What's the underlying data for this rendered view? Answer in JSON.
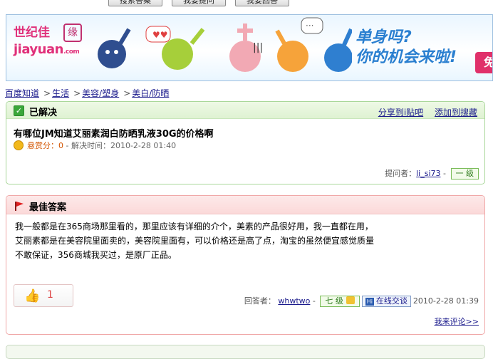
{
  "top_buttons": [
    "搜索答案",
    "我要提问",
    "我要回答"
  ],
  "banner": {
    "logo_cn": "世纪佳",
    "logo_mark": "缘",
    "logo_en": "jiayuan",
    "logo_domain": ".com",
    "slogan_line1": "单身吗?",
    "slogan_line2": "你的机会来啦!",
    "button_label": "免"
  },
  "breadcrumb": [
    "百度知道",
    "生活",
    "美容/塑身",
    "美白/防晒"
  ],
  "breadcrumb_sep": ">",
  "question": {
    "status": "已解决",
    "share_link": "分享到i贴吧",
    "favorite_link": "添加到搜藏",
    "title": "有哪位JM知道艾丽素润白防晒乳液30G的价格啊",
    "reward_label": "悬赏分：0",
    "resolved_time": " - 解决时间：2010-2-28 01:40",
    "asker_label": "提问者：",
    "asker_name": "li_si73",
    "asker_level": "一 级"
  },
  "best_answer": {
    "title": "最佳答案",
    "lines": [
      "我一般都是在365商场那里看的，那里应该有详细的介个，美素的产品很好用，我一直都在用，",
      "艾丽素都是在美容院里面卖的，美容院里面有，可以价格还是高了点，淘宝的虽然便宜感觉质量",
      "不敢保证，356商城我买过，是原厂正品。"
    ],
    "likes": "1",
    "answerer_label": "回答者：",
    "answerer_name": "whwtwo",
    "answerer_level": "七 级",
    "online_label": "在线交谈",
    "time": "2010-2-28 01:39",
    "comment_link": "我来评论>>"
  },
  "colors": {
    "solved_border": "#a9d79a",
    "best_border": "#f0a7a7",
    "link": "#1a1a8c",
    "reward": "#d35400"
  }
}
